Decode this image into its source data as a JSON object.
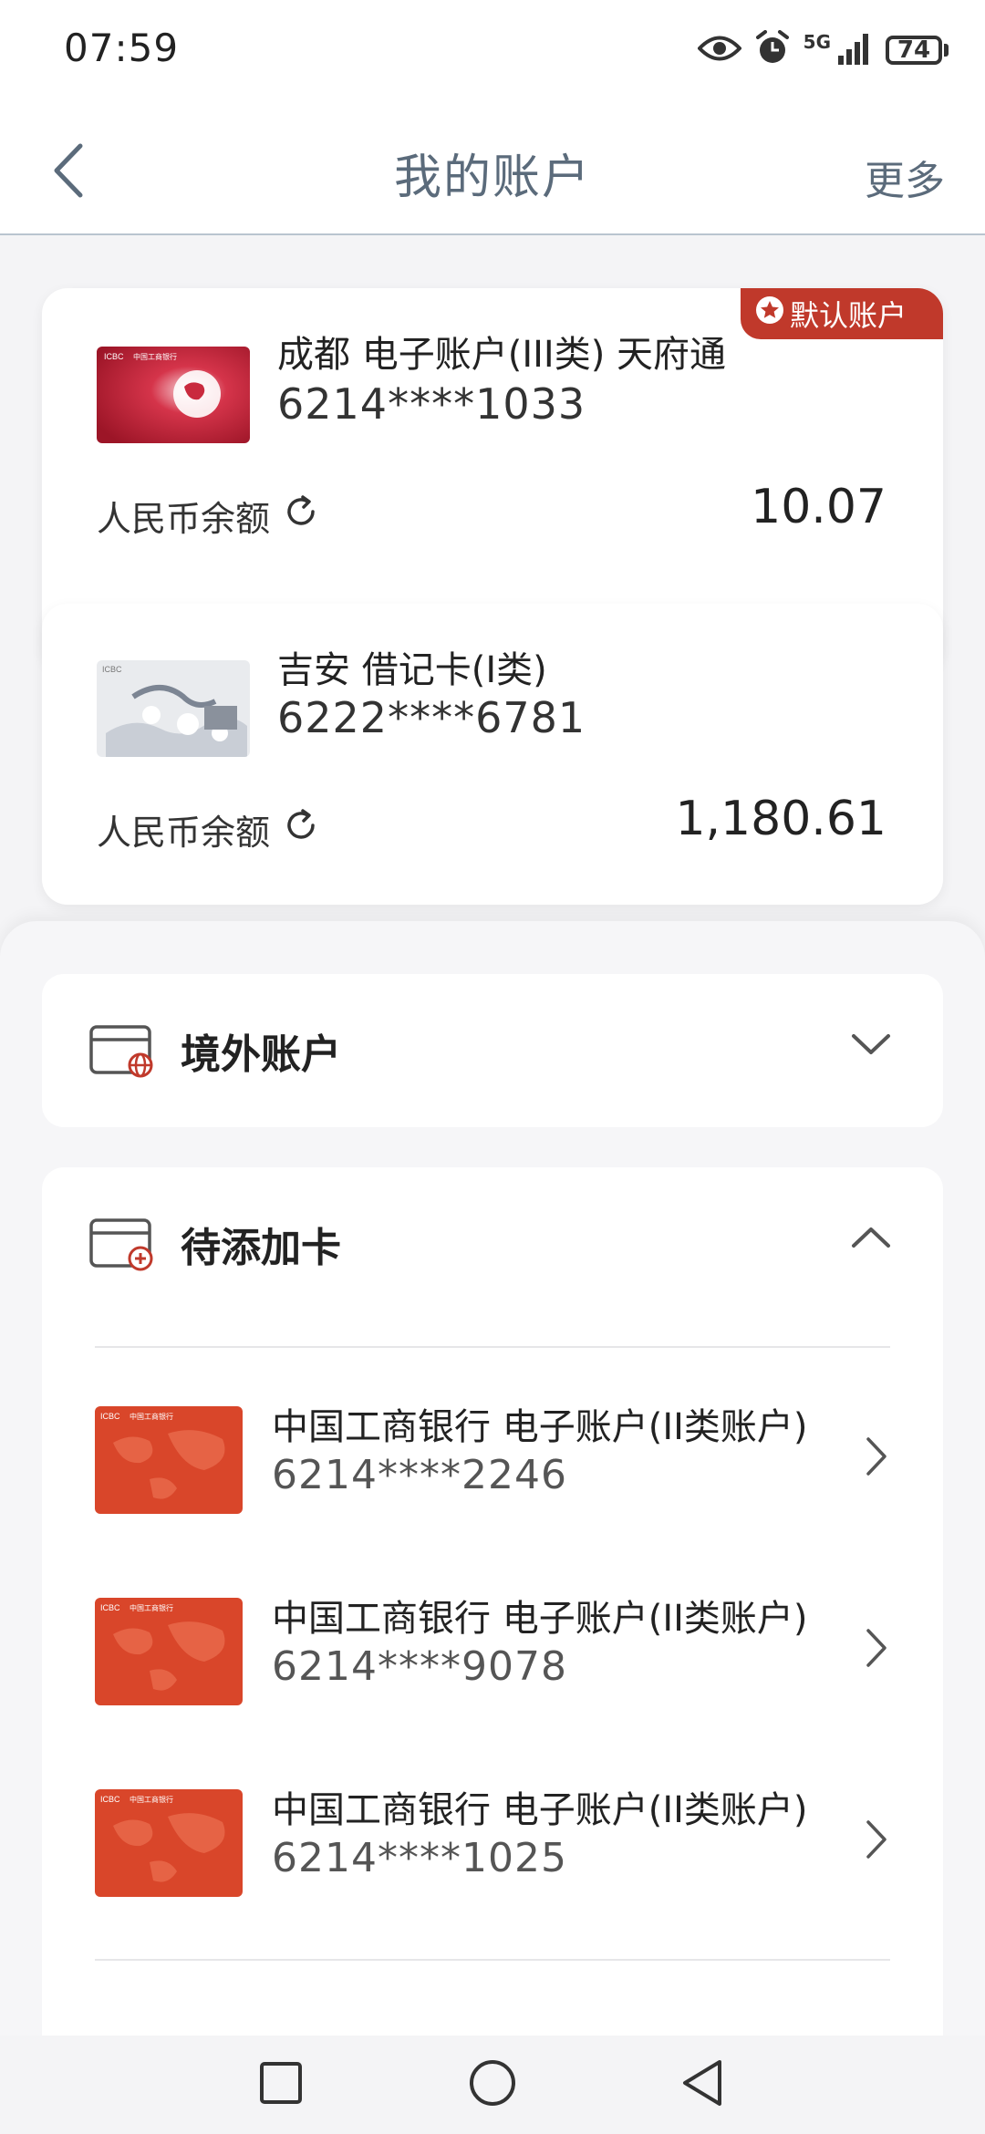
{
  "status_bar": {
    "time": "07:59",
    "network": "5G",
    "battery": "74",
    "icons": [
      "eye-icon",
      "alarm-icon",
      "signal-icon",
      "battery-icon"
    ]
  },
  "nav": {
    "title": "我的账户",
    "more": "更多",
    "back_icon": "chevron-left-icon"
  },
  "accounts": [
    {
      "name": "成都 电子账户(III类) 天府通",
      "number": "6214****1033",
      "balance_label": "人民币余额",
      "balance": "10.07",
      "badge": "默认账户",
      "card_color": "#c8283a"
    },
    {
      "name": "吉安 借记卡(I类)",
      "number": "6222****6781",
      "balance_label": "人民币余额",
      "balance": "1,180.61",
      "card_color": "#d9dde3"
    }
  ],
  "sections": {
    "overseas": {
      "title": "境外账户",
      "icon": "card-globe-icon",
      "chevron": "chevron-down-icon"
    },
    "pending": {
      "title": "待添加卡",
      "icon": "card-add-icon",
      "chevron": "chevron-up-icon",
      "items": [
        {
          "name": "中国工商银行 电子账户(II类账户)",
          "number": "6214****2246"
        },
        {
          "name": "中国工商银行 电子账户(II类账户)",
          "number": "6214****9078"
        },
        {
          "name": "中国工商银行 电子账户(II类账户)",
          "number": "6214****1025"
        }
      ]
    }
  },
  "card_thumb_text": {
    "brand": "ICBC",
    "bank": "中国工商银行"
  },
  "colors": {
    "accent_red": "#c0392b",
    "card_orange": "#d9462a",
    "nav_text": "#5b6b7b"
  },
  "system_nav": [
    "square-icon",
    "circle-icon",
    "triangle-back-icon"
  ]
}
